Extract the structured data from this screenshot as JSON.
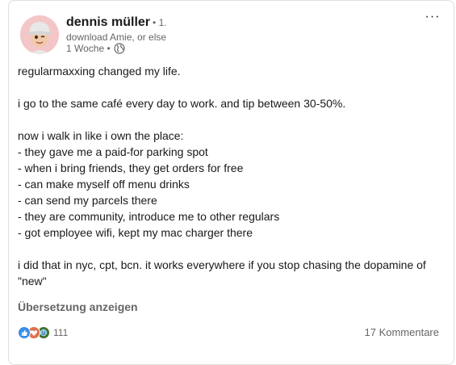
{
  "author": {
    "name": "dennis müller",
    "degree": "• 1.",
    "headline": "download Amie, or else",
    "time": "1 Woche •"
  },
  "post": {
    "lines": [
      "regularmaxxing changed my life.",
      "",
      "i go to the same café every day to work. and tip between 30-50%.",
      "",
      "now i walk in like i own the place:",
      "- they gave me a paid-for parking spot",
      "- when i bring friends, they get orders for free",
      "- can make myself off menu drinks",
      "- can send my parcels there",
      "- they are community, introduce me to other regulars",
      "- got employee wifi, kept my mac charger there",
      "",
      "i did that in nyc, cpt, bcn. it works everywhere if you stop chasing the dopamine of \"new\""
    ]
  },
  "actions": {
    "translate_label": "Übersetzung anzeigen",
    "menu_label": "···"
  },
  "social": {
    "reaction_count": "111",
    "reaction_icons": [
      "like-icon",
      "love-icon",
      "funny-icon"
    ],
    "comments_label": "17 Kommentare"
  },
  "colors": {
    "like": "#378fe9",
    "love": "#df704d",
    "funny": "#44712e",
    "avatar_bg": "#f3c6c8"
  }
}
